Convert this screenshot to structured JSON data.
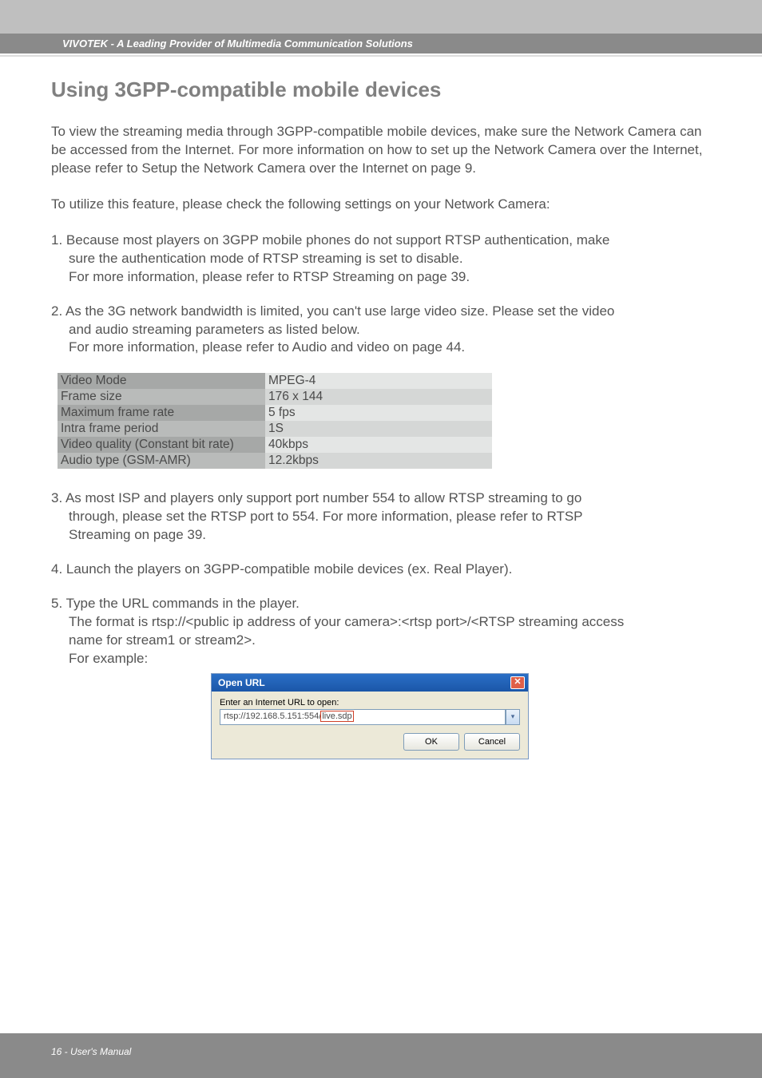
{
  "header": {
    "brand_tagline": "VIVOTEK - A Leading Provider of Multimedia Communication Solutions"
  },
  "section": {
    "title": "Using 3GPP-compatible mobile devices"
  },
  "paragraphs": {
    "intro": "To view the streaming media through 3GPP-compatible mobile devices, make sure the Network Camera can be accessed from the Internet. For more information on how to set up the Network Camera over the Internet, please refer to Setup the Network Camera over the Internet on page 9.",
    "utilize": "To utilize this feature, please check the following settings on your Network Camera:"
  },
  "steps": {
    "s1_line1": "1. Because most players on 3GPP mobile phones do not support RTSP authentication, make",
    "s1_line2": "sure the authentication mode of RTSP streaming is set to disable.",
    "s1_line3": "For more information, please refer to RTSP Streaming on page 39.",
    "s2_line1": "2. As the 3G network bandwidth is limited, you can't use large video size. Please set the video",
    "s2_line2": "and audio streaming parameters as listed below.",
    "s2_line3": "For more information, please refer to Audio and video on page 44.",
    "s3_line1": "3. As most ISP and players only support port number 554 to allow RTSP streaming to go",
    "s3_line2": "through, please set the RTSP port to 554. For more information, please refer to RTSP",
    "s3_line3": "Streaming on page 39.",
    "s4": "4. Launch the players on 3GPP-compatible mobile devices (ex. Real Player).",
    "s5_line1": "5. Type the URL commands in the player.",
    "s5_line2": "The format is rtsp://<public ip address of your camera>:<rtsp port>/<RTSP streaming access",
    "s5_line3": "name for stream1 or stream2>.",
    "s5_line4": "For example:"
  },
  "settings_table": {
    "rows": [
      {
        "label": "Video Mode",
        "value": "MPEG-4"
      },
      {
        "label": "Frame size",
        "value": "176 x 144"
      },
      {
        "label": "Maximum frame rate",
        "value": "5 fps"
      },
      {
        "label": "Intra frame period",
        "value": "1S"
      },
      {
        "label": "Video quality (Constant bit rate)",
        "value": "40kbps"
      },
      {
        "label": "Audio type (GSM-AMR)",
        "value": "12.2kbps"
      }
    ]
  },
  "dialog": {
    "title": "Open URL",
    "label": "Enter an Internet URL to open:",
    "url_prefix": "rtsp://192.168.5.151:554/",
    "url_highlight": "live.sdp",
    "ok": "OK",
    "cancel": "Cancel"
  },
  "footer": {
    "page": "16 - User's Manual"
  }
}
